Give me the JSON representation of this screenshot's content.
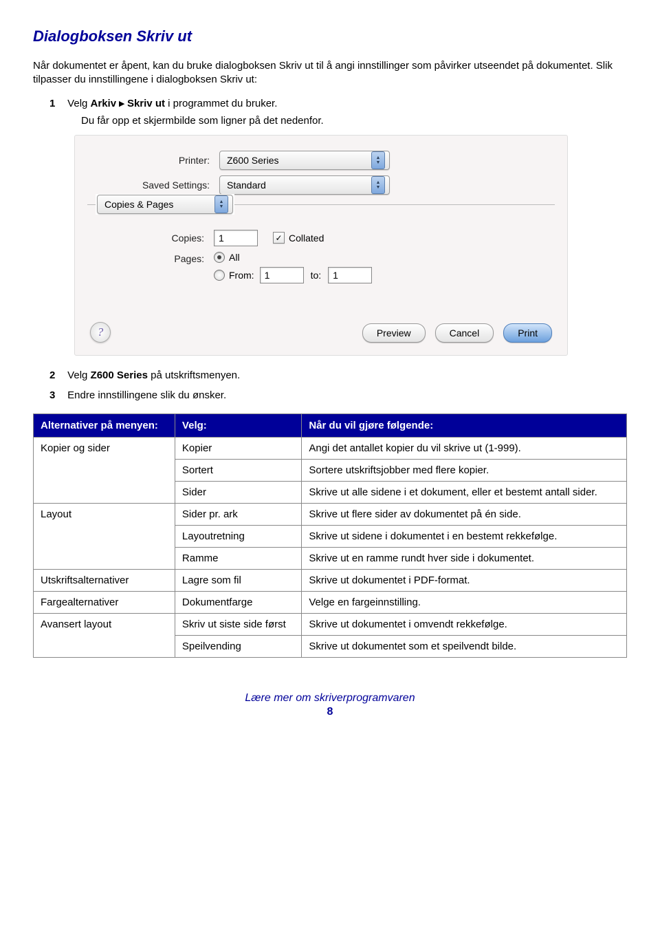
{
  "title": "Dialogboksen Skriv ut",
  "intro1": "Når dokumentet er åpent, kan du bruke dialogboksen Skriv ut til å angi innstillinger som påvirker utseendet på dokumentet. Slik tilpasser du innstillingene i dialogboksen Skriv ut:",
  "step1_pre": "Velg ",
  "step1_bold1": "Arkiv",
  "step1_arrow": "▸",
  "step1_bold2": "Skriv ut",
  "step1_post": " i programmet du bruker.",
  "step1_sub": "Du får opp et skjermbilde som ligner på det nedenfor.",
  "step2_pre": "Velg ",
  "step2_bold": "Z600 Series",
  "step2_post": " på utskriftsmenyen.",
  "step3": "Endre innstillingene slik du ønsker.",
  "dlg": {
    "printer_label": "Printer:",
    "printer_value": "Z600 Series",
    "saved_label": "Saved Settings:",
    "saved_value": "Standard",
    "section_value": "Copies & Pages",
    "copies_label": "Copies:",
    "copies_value": "1",
    "collated": "Collated",
    "pages_label": "Pages:",
    "all": "All",
    "from": "From:",
    "from_val": "1",
    "to": "to:",
    "to_val": "1",
    "preview": "Preview",
    "cancel": "Cancel",
    "print": "Print",
    "help": "?"
  },
  "table": {
    "h1": "Alternativer på menyen:",
    "h2": "Velg:",
    "h3": "Når du vil gjøre følgende:",
    "rows": [
      {
        "cat": "Kopier og sider",
        "opt": "Kopier",
        "desc": "Angi det antallet kopier du vil skrive ut (1-999)."
      },
      {
        "cat": "",
        "opt": "Sortert",
        "desc": "Sortere utskriftsjobber med flere kopier."
      },
      {
        "cat": "",
        "opt": "Sider",
        "desc": "Skrive ut alle sidene i et dokument, eller et bestemt antall sider."
      },
      {
        "cat": "Layout",
        "opt": "Sider pr. ark",
        "desc": "Skrive ut flere sider av dokumentet på én side."
      },
      {
        "cat": "",
        "opt": "Layoutretning",
        "desc": "Skrive ut sidene i dokumentet i en bestemt rekkefølge."
      },
      {
        "cat": "",
        "opt": "Ramme",
        "desc": "Skrive ut en ramme rundt hver side i dokumentet."
      },
      {
        "cat": "Utskriftsalternativer",
        "opt": "Lagre som fil",
        "desc": "Skrive ut dokumentet i PDF-format."
      },
      {
        "cat": "Fargealternativer",
        "opt": "Dokumentfarge",
        "desc": "Velge en fargeinnstilling."
      },
      {
        "cat": "Avansert layout",
        "opt": "Skriv ut siste side først",
        "desc": "Skrive ut dokumentet i omvendt rekkefølge."
      },
      {
        "cat": "",
        "opt": "Speilvending",
        "desc": "Skrive ut dokumentet som et speilvendt bilde."
      }
    ]
  },
  "footer_text": "Lære mer om skriverprogramvaren",
  "footer_page": "8"
}
